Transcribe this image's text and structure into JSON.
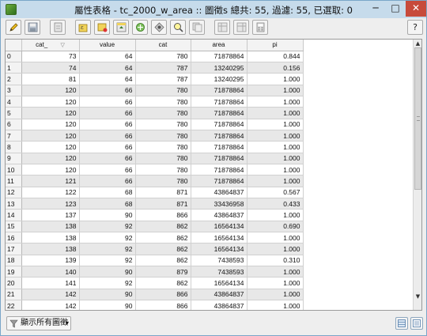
{
  "window": {
    "title": "屬性表格 - tc_2000_w_area :: 圖徵s 總共: 55, 過濾: 55, 已選取: 0",
    "min_glyph": "─",
    "max_glyph": "□",
    "close_glyph": "✕"
  },
  "toolbar": {
    "help_label": "?"
  },
  "table": {
    "columns": [
      "cat_",
      "value",
      "cat",
      "area",
      "pi"
    ],
    "rows": [
      {
        "id": "0",
        "cells": [
          "73",
          "64",
          "780",
          "71878864",
          "0.844"
        ]
      },
      {
        "id": "1",
        "cells": [
          "74",
          "64",
          "787",
          "13240295",
          "0.156"
        ]
      },
      {
        "id": "2",
        "cells": [
          "81",
          "64",
          "787",
          "13240295",
          "1.000"
        ]
      },
      {
        "id": "3",
        "cells": [
          "120",
          "66",
          "780",
          "71878864",
          "1.000"
        ]
      },
      {
        "id": "4",
        "cells": [
          "120",
          "66",
          "780",
          "71878864",
          "1.000"
        ]
      },
      {
        "id": "5",
        "cells": [
          "120",
          "66",
          "780",
          "71878864",
          "1.000"
        ]
      },
      {
        "id": "6",
        "cells": [
          "120",
          "66",
          "780",
          "71878864",
          "1.000"
        ]
      },
      {
        "id": "7",
        "cells": [
          "120",
          "66",
          "780",
          "71878864",
          "1.000"
        ]
      },
      {
        "id": "8",
        "cells": [
          "120",
          "66",
          "780",
          "71878864",
          "1.000"
        ]
      },
      {
        "id": "9",
        "cells": [
          "120",
          "66",
          "780",
          "71878864",
          "1.000"
        ]
      },
      {
        "id": "10",
        "cells": [
          "120",
          "66",
          "780",
          "71878864",
          "1.000"
        ]
      },
      {
        "id": "11",
        "cells": [
          "121",
          "66",
          "780",
          "71878864",
          "1.000"
        ]
      },
      {
        "id": "12",
        "cells": [
          "122",
          "68",
          "871",
          "43864837",
          "0.567"
        ]
      },
      {
        "id": "13",
        "cells": [
          "123",
          "68",
          "871",
          "33436958",
          "0.433"
        ]
      },
      {
        "id": "14",
        "cells": [
          "137",
          "90",
          "866",
          "43864837",
          "1.000"
        ]
      },
      {
        "id": "15",
        "cells": [
          "138",
          "92",
          "862",
          "16564134",
          "0.690"
        ]
      },
      {
        "id": "16",
        "cells": [
          "138",
          "92",
          "862",
          "16564134",
          "1.000"
        ]
      },
      {
        "id": "17",
        "cells": [
          "138",
          "92",
          "862",
          "16564134",
          "1.000"
        ]
      },
      {
        "id": "18",
        "cells": [
          "139",
          "92",
          "862",
          "7438593",
          "0.310"
        ]
      },
      {
        "id": "19",
        "cells": [
          "140",
          "90",
          "879",
          "7438593",
          "1.000"
        ]
      },
      {
        "id": "20",
        "cells": [
          "141",
          "92",
          "862",
          "16564134",
          "1.000"
        ]
      },
      {
        "id": "21",
        "cells": [
          "142",
          "90",
          "866",
          "43864837",
          "1.000"
        ]
      },
      {
        "id": "22",
        "cells": [
          "142",
          "90",
          "866",
          "43864837",
          "1.000"
        ]
      }
    ]
  },
  "bottom": {
    "filter_label": "顯示所有圖徵"
  },
  "icons": {
    "toolbar": [
      "edit-pencil-icon",
      "save-icon",
      "delete-selected-icon",
      "select-by-expression-icon",
      "invert-selection-icon",
      "move-selection-to-top-icon",
      "pan-to-selection-icon",
      "zoom-to-selection-icon",
      "copy-rows-icon",
      "new-column-icon",
      "delete-column-icon",
      "field-calculator-icon",
      "help-icon"
    ]
  }
}
